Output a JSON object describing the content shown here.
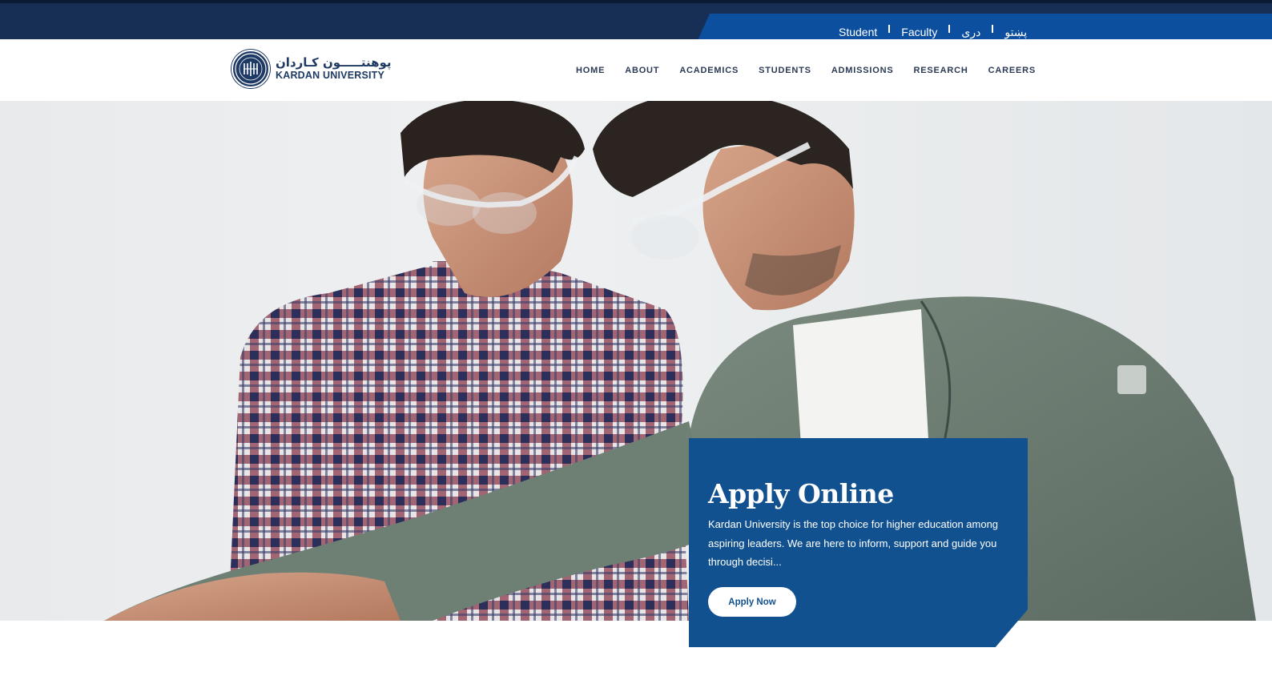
{
  "colors": {
    "topbar": "#172f55",
    "utility_bar": "#0c4f9f",
    "card": "#12518f",
    "nav_text": "#2b3a55",
    "logo": "#1e3a64"
  },
  "utility_links": [
    {
      "label": "Student"
    },
    {
      "label": "Faculty"
    },
    {
      "label": "دری"
    },
    {
      "label": "پښتو"
    }
  ],
  "logo": {
    "arabic_text": "پوهنتـــــون کـاردان",
    "english_text": "KARDAN UNIVERSITY",
    "icon": "university-seal-icon"
  },
  "nav": [
    {
      "label": "HOME"
    },
    {
      "label": "ABOUT"
    },
    {
      "label": "ACADEMICS"
    },
    {
      "label": "STUDENTS"
    },
    {
      "label": "ADMISSIONS"
    },
    {
      "label": "RESEARCH"
    },
    {
      "label": "CAREERS"
    }
  ],
  "hero": {
    "card_title": "Apply Online",
    "card_description": "Kardan University is the top choice for higher education among aspiring leaders. We are here to inform, support and guide you through decisi...",
    "button_label": "Apply Now"
  }
}
